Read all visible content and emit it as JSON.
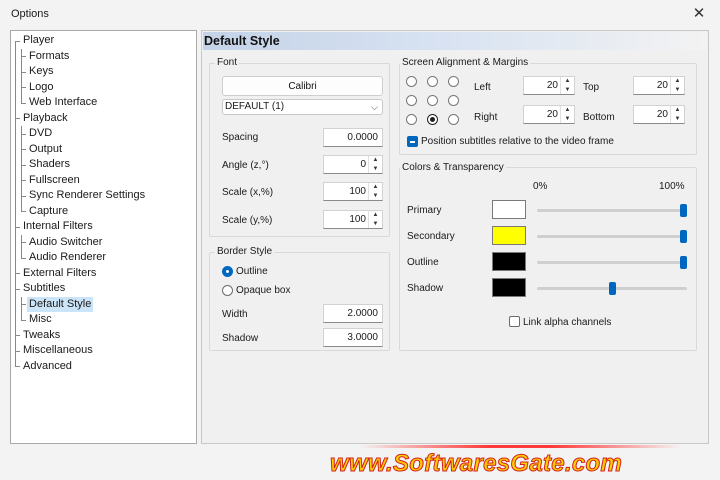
{
  "window": {
    "title": "Options",
    "close_glyph": "✕"
  },
  "tree": {
    "items": [
      {
        "label": "Player",
        "level": 0,
        "name": "tree-item-player"
      },
      {
        "label": "Formats",
        "level": 1,
        "name": "tree-item-formats"
      },
      {
        "label": "Keys",
        "level": 1,
        "name": "tree-item-keys"
      },
      {
        "label": "Logo",
        "level": 1,
        "name": "tree-item-logo"
      },
      {
        "label": "Web Interface",
        "level": 1,
        "name": "tree-item-web-interface"
      },
      {
        "label": "Playback",
        "level": 0,
        "name": "tree-item-playback"
      },
      {
        "label": "DVD",
        "level": 1,
        "name": "tree-item-dvd"
      },
      {
        "label": "Output",
        "level": 1,
        "name": "tree-item-output"
      },
      {
        "label": "Shaders",
        "level": 1,
        "name": "tree-item-shaders"
      },
      {
        "label": "Fullscreen",
        "level": 1,
        "name": "tree-item-fullscreen"
      },
      {
        "label": "Sync Renderer Settings",
        "level": 1,
        "name": "tree-item-sync-renderer-settings"
      },
      {
        "label": "Capture",
        "level": 1,
        "name": "tree-item-capture"
      },
      {
        "label": "Internal Filters",
        "level": 0,
        "name": "tree-item-internal-filters"
      },
      {
        "label": "Audio Switcher",
        "level": 1,
        "name": "tree-item-audio-switcher"
      },
      {
        "label": "Audio Renderer",
        "level": 1,
        "name": "tree-item-audio-renderer"
      },
      {
        "label": "External Filters",
        "level": 0,
        "name": "tree-item-external-filters"
      },
      {
        "label": "Subtitles",
        "level": 0,
        "name": "tree-item-subtitles"
      },
      {
        "label": "Default Style",
        "level": 1,
        "name": "tree-item-default-style",
        "selected": true
      },
      {
        "label": "Misc",
        "level": 1,
        "name": "tree-item-misc"
      },
      {
        "label": "Tweaks",
        "level": 0,
        "name": "tree-item-tweaks"
      },
      {
        "label": "Miscellaneous",
        "level": 0,
        "name": "tree-item-miscellaneous"
      },
      {
        "label": "Advanced",
        "level": 0,
        "name": "tree-item-advanced"
      }
    ]
  },
  "page": {
    "title": "Default Style"
  },
  "font": {
    "group_title": "Font",
    "font_button": "Calibri",
    "charset_value": "DEFAULT (1)",
    "spacing_label": "Spacing",
    "spacing_value": "0.0000",
    "angle_label": "Angle (z,°)",
    "angle_value": "0",
    "scale_x_label": "Scale (x,%)",
    "scale_x_value": "100",
    "scale_y_label": "Scale (y,%)",
    "scale_y_value": "100"
  },
  "border": {
    "group_title": "Border Style",
    "outline_label": "Outline",
    "opaque_label": "Opaque box",
    "selected": "outline",
    "width_label": "Width",
    "width_value": "2.0000",
    "shadow_label": "Shadow",
    "shadow_value": "3.0000"
  },
  "alignment": {
    "group_title": "Screen Alignment & Margins",
    "selected_position": "bottom-center",
    "left_label": "Left",
    "left_value": "20",
    "top_label": "Top",
    "top_value": "20",
    "right_label": "Right",
    "right_value": "20",
    "bottom_label": "Bottom",
    "bottom_value": "20",
    "relative_label": "Position subtitles relative to the video frame",
    "relative_checked": true
  },
  "colors": {
    "group_title": "Colors & Transparency",
    "pct_min": "0%",
    "pct_max": "100%",
    "rows": [
      {
        "label": "Primary",
        "color": "#ffffff",
        "alpha_pct": 100
      },
      {
        "label": "Secondary",
        "color": "#ffff00",
        "alpha_pct": 100
      },
      {
        "label": "Outline",
        "color": "#000000",
        "alpha_pct": 100
      },
      {
        "label": "Shadow",
        "color": "#000000",
        "alpha_pct": 50
      }
    ],
    "link_alpha_label": "Link alpha channels",
    "link_alpha_checked": false
  },
  "theme": {
    "accent": "#0067c0",
    "selection": "#cce4f7"
  },
  "watermark": {
    "text": "www.SoftwaresGate.com"
  }
}
